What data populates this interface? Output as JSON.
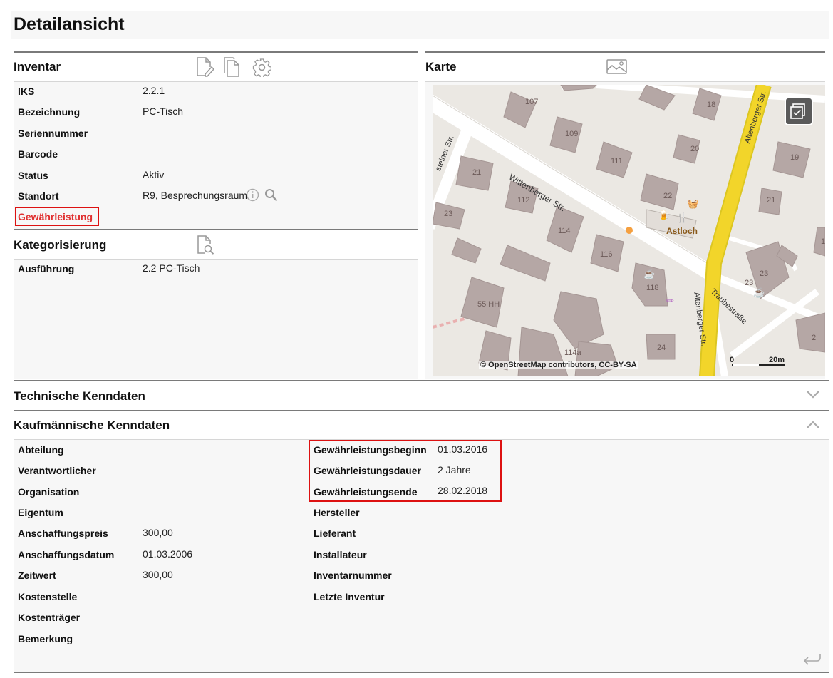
{
  "page": {
    "title": "Detailansicht"
  },
  "inventar": {
    "heading": "Inventar",
    "fields": [
      {
        "label": "IKS",
        "value": "2.2.1"
      },
      {
        "label": "Bezeichnung",
        "value": "PC-Tisch"
      },
      {
        "label": "Seriennummer",
        "value": ""
      },
      {
        "label": "Barcode",
        "value": ""
      },
      {
        "label": "Status",
        "value": "Aktiv"
      },
      {
        "label": "Standort",
        "value": "R9, Besprechungsraum"
      }
    ],
    "warranty_link": "Gewährleistung",
    "icons": [
      "edit-document-icon",
      "copy-document-icon",
      "settings-gear-icon"
    ]
  },
  "kategorisierung": {
    "heading": "Kategorisierung",
    "fields": [
      {
        "label": "Ausführung",
        "value": "2.2 PC-Tisch"
      }
    ]
  },
  "karte": {
    "heading": "Karte",
    "attribution": "© OpenStreetMap contributors, CC-BY-SA",
    "scale_start": "0",
    "scale_end": "20m",
    "labels": {
      "street_wittenberger": "Wittenberger Str.",
      "street_altenberger_top": "Altenberger Str.",
      "street_altenberger_bottom": "Altenberger Str.",
      "street_traube": "Traubestraße",
      "street_steiner": "steiner Str.",
      "poi_astloch": "Astloch",
      "h107": "107",
      "h18": "18",
      "h109": "109",
      "h20": "20",
      "h111": "111",
      "h19": "19",
      "h21a": "21",
      "h22": "22",
      "h21b": "21",
      "h112": "112",
      "h23a": "23",
      "h114": "114",
      "h116": "116",
      "h23b": "23",
      "h23c": "23",
      "h118": "118",
      "h55": "55 HH",
      "h24": "24",
      "h114a": "114a",
      "h2": "2",
      "h1": "1"
    }
  },
  "technische": {
    "heading": "Technische Kenndaten"
  },
  "kaufmaennische": {
    "heading": "Kaufmännische Kenndaten",
    "left": [
      {
        "label": "Abteilung",
        "value": ""
      },
      {
        "label": "Verantwortlicher",
        "value": ""
      },
      {
        "label": "Organisation",
        "value": ""
      },
      {
        "label": "Eigentum",
        "value": ""
      },
      {
        "label": "Anschaffungspreis",
        "value": "300,00"
      },
      {
        "label": "Anschaffungsdatum",
        "value": "01.03.2006"
      },
      {
        "label": "Zeitwert",
        "value": "300,00"
      },
      {
        "label": "Kostenstelle",
        "value": ""
      },
      {
        "label": "Kostenträger",
        "value": ""
      },
      {
        "label": "Bemerkung",
        "value": ""
      }
    ],
    "right": [
      {
        "label": "Gewährleistungsbeginn",
        "value": "01.03.2016"
      },
      {
        "label": "Gewährleistungsdauer",
        "value": "2 Jahre"
      },
      {
        "label": "Gewährleistungsende",
        "value": "28.02.2018"
      },
      {
        "label": "Hersteller",
        "value": ""
      },
      {
        "label": "Lieferant",
        "value": ""
      },
      {
        "label": "Installateur",
        "value": ""
      },
      {
        "label": "Inventarnummer",
        "value": ""
      },
      {
        "label": "Letzte Inventur",
        "value": ""
      }
    ]
  },
  "colors": {
    "accent_red": "#e03030",
    "highlight_box": "#d11111",
    "road_yellow": "#f2d52a"
  }
}
